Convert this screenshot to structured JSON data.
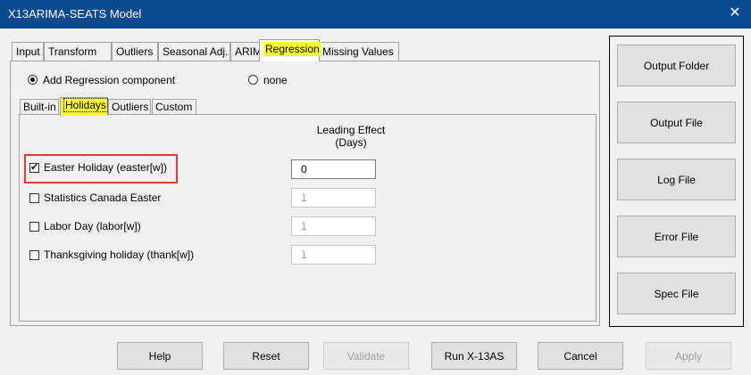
{
  "window": {
    "title": "X13ARIMA-SEATS Model",
    "close_glyph": "✕"
  },
  "tabs": [
    {
      "label": "Input"
    },
    {
      "label": "Transform"
    },
    {
      "label": "Outliers"
    },
    {
      "label": "Seasonal Adj."
    },
    {
      "label": "ARIMA"
    },
    {
      "label": "Regression"
    },
    {
      "label": "Missing Values"
    }
  ],
  "regression": {
    "add_label": "Add Regression component",
    "none_label": "none"
  },
  "subtabs": [
    {
      "label": "Built-in"
    },
    {
      "label": "Holidays"
    },
    {
      "label": "Outliers"
    },
    {
      "label": "Custom"
    }
  ],
  "holidays": {
    "header_line1": "Leading Effect",
    "header_line2": "(Days)",
    "rows": [
      {
        "label": "Easter Holiday (easter[w])",
        "value": "0"
      },
      {
        "label": "Statistics Canada Easter",
        "value": "1"
      },
      {
        "label": "Labor Day (labor[w])",
        "value": "1"
      },
      {
        "label": "Thanksgiving holiday (thank[w])",
        "value": "1"
      }
    ]
  },
  "side_buttons": {
    "output_folder": "Output Folder",
    "output_file": "Output File",
    "log_file": "Log File",
    "error_file": "Error File",
    "spec_file": "Spec File"
  },
  "bottom_buttons": {
    "help": "Help",
    "reset": "Reset",
    "validate": "Validate",
    "run": "Run X-13AS",
    "cancel": "Cancel",
    "apply": "Apply"
  },
  "colors": {
    "titlebar": "#0b4a8e",
    "tab_highlight": "#ffff33",
    "annotation_box": "#d9403a"
  }
}
